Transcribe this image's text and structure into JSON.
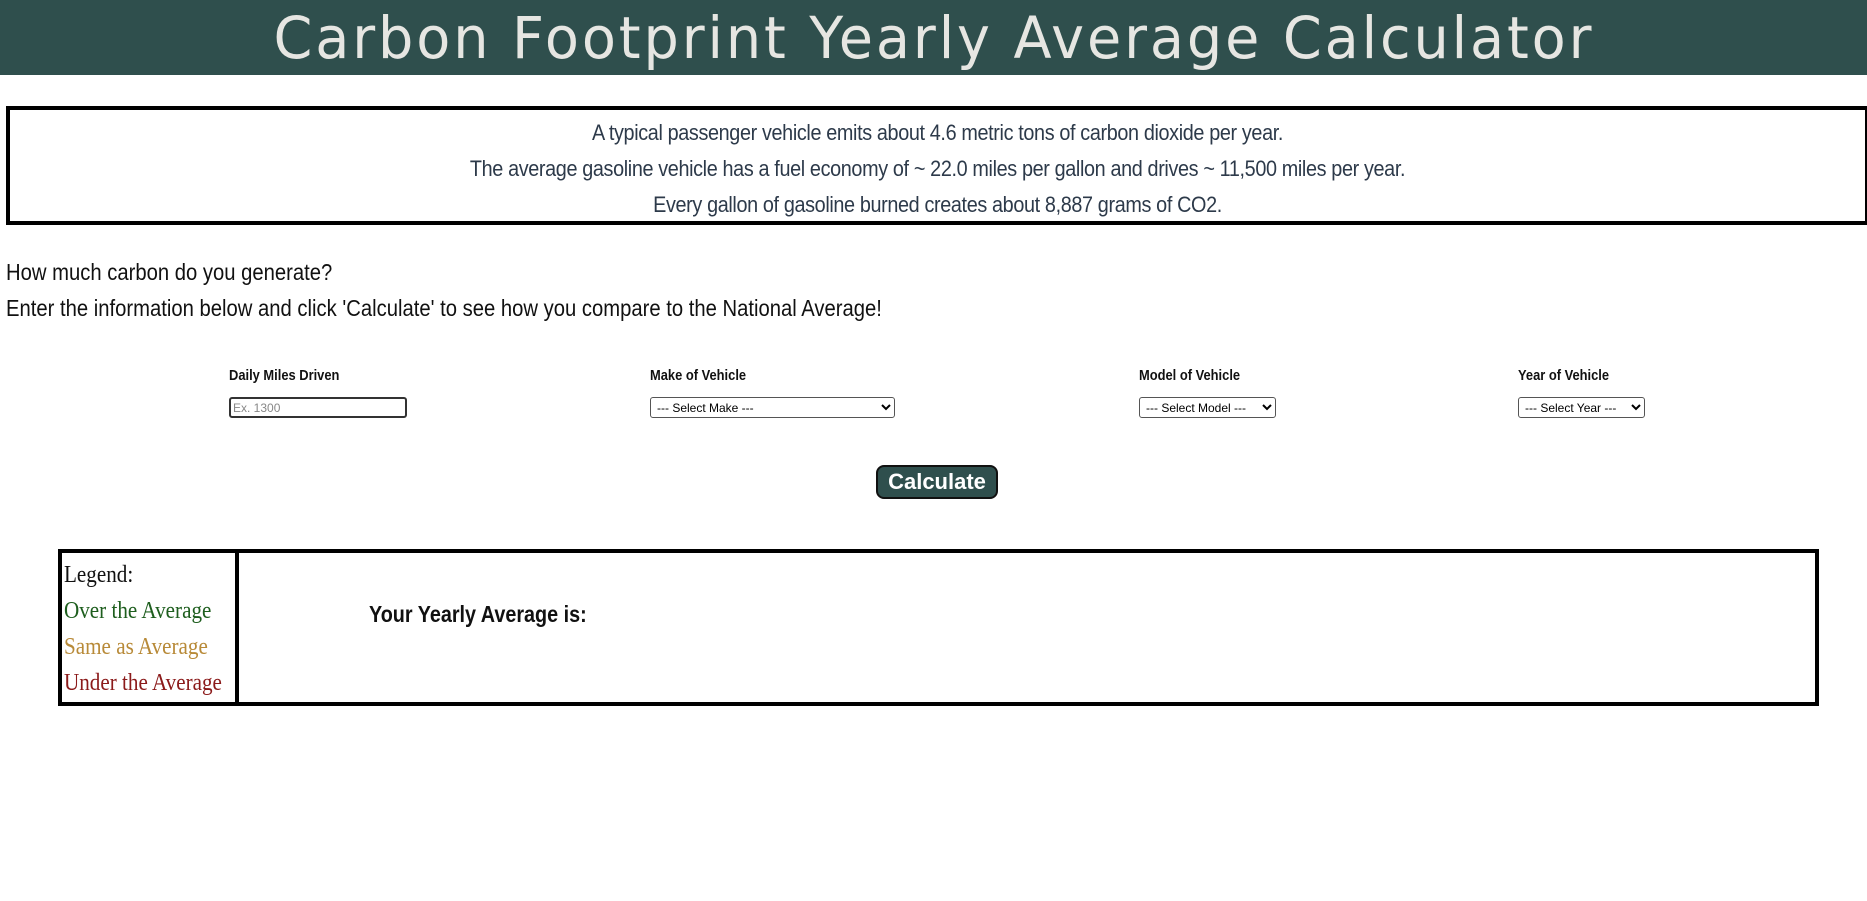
{
  "header": {
    "title": "Carbon Footprint Yearly Average Calculator"
  },
  "info": {
    "lines": [
      "A typical passenger vehicle emits about 4.6 metric tons of carbon dioxide per year.",
      "The average gasoline vehicle has a fuel economy of ~ 22.0 miles per gallon and drives ~ 11,500 miles per year.",
      "Every gallon of gasoline burned creates about 8,887 grams of CO2."
    ]
  },
  "intro": {
    "question": "How much carbon do you generate?",
    "instructions": "Enter the information below and click 'Calculate' to see how you compare to the National Average!"
  },
  "form": {
    "miles": {
      "label": "Daily Miles Driven",
      "value": "",
      "placeholder": "Ex. 1300"
    },
    "make": {
      "label": "Make of Vehicle",
      "selected": "--- Select Make ---"
    },
    "model": {
      "label": "Model of Vehicle",
      "selected": "--- Select Model ---"
    },
    "year": {
      "label": "Year of Vehicle",
      "selected": "--- Select Year ---"
    },
    "calculate_label": "Calculate"
  },
  "legend": {
    "title": "Legend:",
    "over": "Over the Average",
    "same": "Same as Average",
    "under": "Under the Average"
  },
  "results": {
    "yearly_label": "Your Yearly Average is:"
  },
  "colors": {
    "header_bg": "#2f4f4d",
    "over": "#1e5e1e",
    "same": "#b88a38",
    "under": "#8b1a1a"
  }
}
